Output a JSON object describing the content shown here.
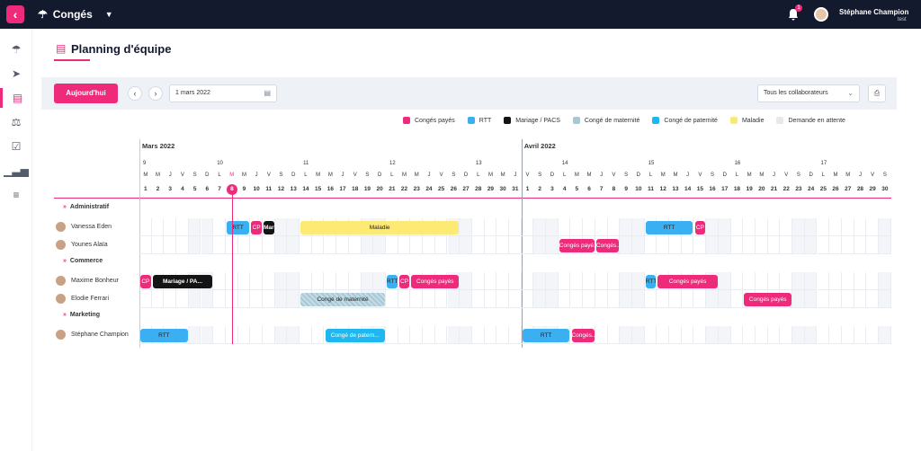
{
  "app": {
    "name": "Congés",
    "logo_letter": "‹"
  },
  "topbar": {
    "user_name": "Stéphane Champion",
    "user_sub": "test",
    "notif_count": "1"
  },
  "sidebar": {
    "items": [
      {
        "icon": "beach-umbrella-icon",
        "glyph": "☂"
      },
      {
        "icon": "paper-plane-icon",
        "glyph": "➤"
      },
      {
        "icon": "calendar-icon",
        "glyph": "▤",
        "active": true
      },
      {
        "icon": "balance-scale-icon",
        "glyph": "⚖"
      },
      {
        "icon": "calendar-check-icon",
        "glyph": "☑"
      },
      {
        "icon": "bar-chart-icon",
        "glyph": "▁▃▅"
      },
      {
        "icon": "settings-sliders-icon",
        "glyph": "≡"
      }
    ]
  },
  "page": {
    "title": "Planning d'équipe"
  },
  "toolbar": {
    "today_label": "Aujourd'hui",
    "prev": "‹",
    "next": "›",
    "date_value": "1 mars 2022",
    "collab_value": "Tous les collaborateurs"
  },
  "legend": [
    {
      "label": "Congés payés",
      "color": "#ee2a7b"
    },
    {
      "label": "RTT",
      "color": "#3ab0f2"
    },
    {
      "label": "Mariage / PACS",
      "color": "#141414"
    },
    {
      "label": "Congé de maternité",
      "color": "#a7c9d6"
    },
    {
      "label": "Congé de paternité",
      "color": "#1fb7f0"
    },
    {
      "label": "Maladie",
      "color": "#fdea74"
    },
    {
      "label": "Demande en attente",
      "color": "#e6e8ec"
    }
  ],
  "months": [
    {
      "label": "Mars 2022",
      "start_index": 0
    },
    {
      "label": "Avril 2022",
      "start_index": 31
    }
  ],
  "weeks": [
    {
      "label": "9",
      "start_index": 0
    },
    {
      "label": "10",
      "start_index": 6
    },
    {
      "label": "11",
      "start_index": 13
    },
    {
      "label": "12",
      "start_index": 20
    },
    {
      "label": "13",
      "start_index": 27
    },
    {
      "label": "14",
      "start_index": 34
    },
    {
      "label": "15",
      "start_index": 41
    },
    {
      "label": "16",
      "start_index": 48
    },
    {
      "label": "17",
      "start_index": 55
    }
  ],
  "days": {
    "letters": [
      "M",
      "M",
      "J",
      "V",
      "S",
      "D",
      "L",
      "M",
      "M",
      "J",
      "V",
      "S",
      "D",
      "L",
      "M",
      "M",
      "J",
      "V",
      "S",
      "D",
      "L",
      "M",
      "M",
      "J",
      "V",
      "S",
      "D",
      "L",
      "M",
      "M",
      "J",
      "V",
      "S",
      "D",
      "L",
      "M",
      "M",
      "J",
      "V",
      "S",
      "D",
      "L",
      "M",
      "M",
      "J",
      "V",
      "S",
      "D",
      "L",
      "M",
      "M",
      "J",
      "V",
      "S",
      "D",
      "L",
      "M",
      "M",
      "J",
      "V",
      "S"
    ],
    "numbers": [
      "1",
      "2",
      "3",
      "4",
      "5",
      "6",
      "7",
      "8",
      "9",
      "10",
      "11",
      "12",
      "13",
      "14",
      "15",
      "16",
      "17",
      "18",
      "19",
      "20",
      "21",
      "22",
      "23",
      "24",
      "25",
      "26",
      "27",
      "28",
      "29",
      "30",
      "31",
      "1",
      "2",
      "3",
      "4",
      "5",
      "6",
      "7",
      "8",
      "9",
      "10",
      "11",
      "12",
      "13",
      "14",
      "15",
      "16",
      "17",
      "18",
      "19",
      "20",
      "21",
      "22",
      "23",
      "24",
      "25",
      "26",
      "27",
      "28",
      "29",
      "30"
    ],
    "today_index": 7
  },
  "groups": [
    {
      "label": "Administratif",
      "employees": [
        {
          "name": "Vanessa Eden",
          "events": [
            {
              "type": "RTT",
              "label": "RTT",
              "start": 7,
              "end": 8
            },
            {
              "type": "CP",
              "label": "CP",
              "start": 9,
              "end": 9
            },
            {
              "type": "MAR",
              "label": "Mar",
              "start": 10,
              "end": 10
            },
            {
              "type": "MAL",
              "label": "Maladie",
              "start": 13,
              "end": 25
            },
            {
              "type": "RTT",
              "label": "RTT",
              "start": 41,
              "end": 44
            },
            {
              "type": "CP",
              "label": "CP",
              "start": 45,
              "end": 45
            }
          ]
        },
        {
          "name": "Younes Alaïa",
          "events": [
            {
              "type": "CP",
              "label": "Congés payé...",
              "start": 34,
              "end": 36
            },
            {
              "type": "CP",
              "label": "Congés...",
              "start": 37,
              "end": 38
            }
          ]
        }
      ]
    },
    {
      "label": "Commerce",
      "employees": [
        {
          "name": "Maxime Bonheur",
          "events": [
            {
              "type": "CP",
              "label": "CP",
              "start": 0,
              "end": 0
            },
            {
              "type": "MAR",
              "label": "Mariage / PA...",
              "start": 1,
              "end": 5
            },
            {
              "type": "RTT",
              "label": "RTT",
              "start": 20,
              "end": 20
            },
            {
              "type": "CP",
              "label": "CP",
              "start": 21,
              "end": 21
            },
            {
              "type": "CP",
              "label": "Congés payés",
              "start": 22,
              "end": 25
            },
            {
              "type": "RTT",
              "label": "RTT",
              "start": 41,
              "end": 41
            },
            {
              "type": "CP",
              "label": "Congés payés",
              "start": 42,
              "end": 46
            }
          ]
        },
        {
          "name": "Elodie Ferrari",
          "events": [
            {
              "type": "MAT",
              "label": "Congé de maternité",
              "start": 13,
              "end": 19
            },
            {
              "type": "CP",
              "label": "Congés payés",
              "start": 49,
              "end": 52
            }
          ]
        }
      ]
    },
    {
      "label": "Marketing",
      "employees": [
        {
          "name": "Stéphane Champion",
          "events": [
            {
              "type": "RTT",
              "label": "RTT",
              "start": 0,
              "end": 3
            },
            {
              "type": "PAT",
              "label": "Congé de patern...",
              "start": 15,
              "end": 19
            },
            {
              "type": "RTT",
              "label": "RTT",
              "start": 31,
              "end": 34
            },
            {
              "type": "CP",
              "label": "Congés...",
              "start": 35,
              "end": 36
            }
          ]
        }
      ]
    }
  ],
  "event_colors": {
    "CP": "#ee2a7b",
    "RTT": "#3ab0f2",
    "MAR": "#141414",
    "MAT": "#a7c9d6",
    "PAT": "#1fb7f0",
    "MAL": "#fdea74"
  }
}
